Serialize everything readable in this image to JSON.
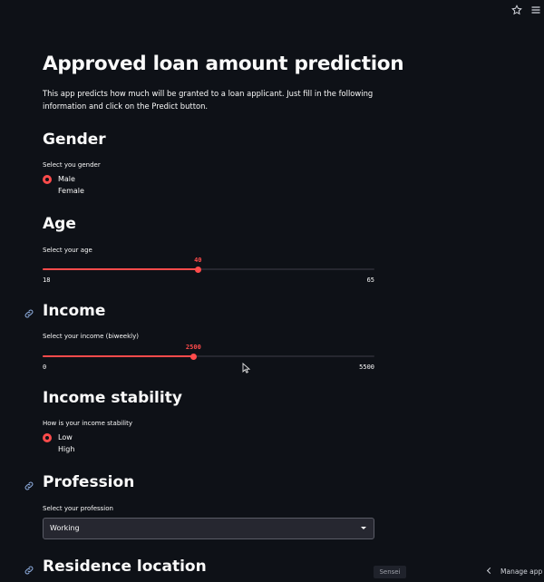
{
  "page": {
    "title": "Approved loan amount prediction",
    "intro": "This app predicts how much will be granted to a loan applicant. Just fill in the following information and click on the Predict button."
  },
  "gender": {
    "heading": "Gender",
    "label": "Select you gender",
    "options": [
      "Male",
      "Female"
    ],
    "selected": "Male"
  },
  "age": {
    "heading": "Age",
    "label": "Select your age",
    "value": 40,
    "min": 18,
    "max": 65
  },
  "income": {
    "heading": "Income",
    "label": "Select your income (biweekly)",
    "value": 2500,
    "min": 0,
    "max": 5500
  },
  "stability": {
    "heading": "Income stability",
    "label": "How is your income stability",
    "options": [
      "Low",
      "High"
    ],
    "selected": "Low"
  },
  "profession": {
    "heading": "Profession",
    "label": "Select your profession",
    "value": "Working"
  },
  "residence": {
    "heading": "Residence location"
  },
  "footer": {
    "badge": "Sensei",
    "manage_app": "Manage app"
  },
  "colors": {
    "background": "#0e1117",
    "accent": "#ff4b4b",
    "text": "#fafafa"
  }
}
